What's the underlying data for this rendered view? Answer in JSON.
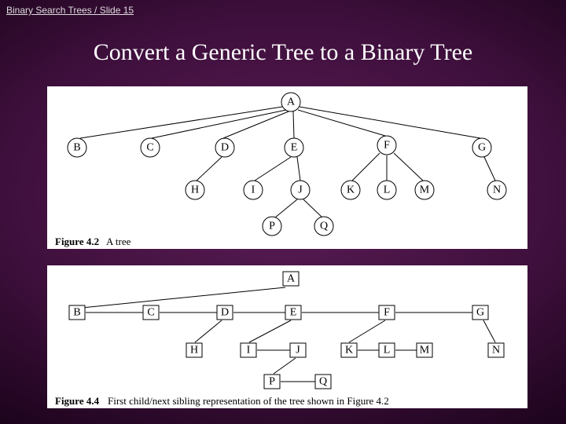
{
  "breadcrumb": "Binary Search Trees / Slide 15",
  "title": "Convert a Generic Tree to a Binary Tree",
  "fig1": {
    "caption_label": "Figure 4.2",
    "caption_text": "A tree",
    "nodes": {
      "A": "A",
      "B": "B",
      "C": "C",
      "D": "D",
      "E": "E",
      "F": "F",
      "G": "G",
      "H": "H",
      "I": "I",
      "J": "J",
      "K": "K",
      "L": "L",
      "M": "M",
      "N": "N",
      "P": "P",
      "Q": "Q"
    }
  },
  "fig2": {
    "caption_label": "Figure 4.4",
    "caption_text": "First child/next sibling representation of the tree shown in Figure 4.2",
    "nodes": {
      "A": "A",
      "B": "B",
      "C": "C",
      "D": "D",
      "E": "E",
      "F": "F",
      "G": "G",
      "H": "H",
      "I": "I",
      "J": "J",
      "K": "K",
      "L": "L",
      "M": "M",
      "N": "N",
      "P": "P",
      "Q": "Q"
    }
  },
  "chart_data": [
    {
      "type": "tree",
      "title": "Figure 4.2 — generic tree",
      "edges": [
        [
          "A",
          "B"
        ],
        [
          "A",
          "C"
        ],
        [
          "A",
          "D"
        ],
        [
          "A",
          "E"
        ],
        [
          "A",
          "F"
        ],
        [
          "A",
          "G"
        ],
        [
          "D",
          "H"
        ],
        [
          "E",
          "I"
        ],
        [
          "E",
          "J"
        ],
        [
          "F",
          "K"
        ],
        [
          "F",
          "L"
        ],
        [
          "F",
          "M"
        ],
        [
          "G",
          "N"
        ],
        [
          "J",
          "P"
        ],
        [
          "J",
          "Q"
        ]
      ]
    },
    {
      "type": "tree",
      "title": "Figure 4.4 — first-child / next-sibling binary encoding",
      "first_child": {
        "A": "B",
        "D": "H",
        "E": "I",
        "F": "K",
        "G": "N",
        "J": "P"
      },
      "next_sibling": {
        "B": "C",
        "C": "D",
        "D": "E",
        "E": "F",
        "F": "G",
        "H": null,
        "I": "J",
        "K": "L",
        "L": "M",
        "P": "Q"
      }
    }
  ]
}
